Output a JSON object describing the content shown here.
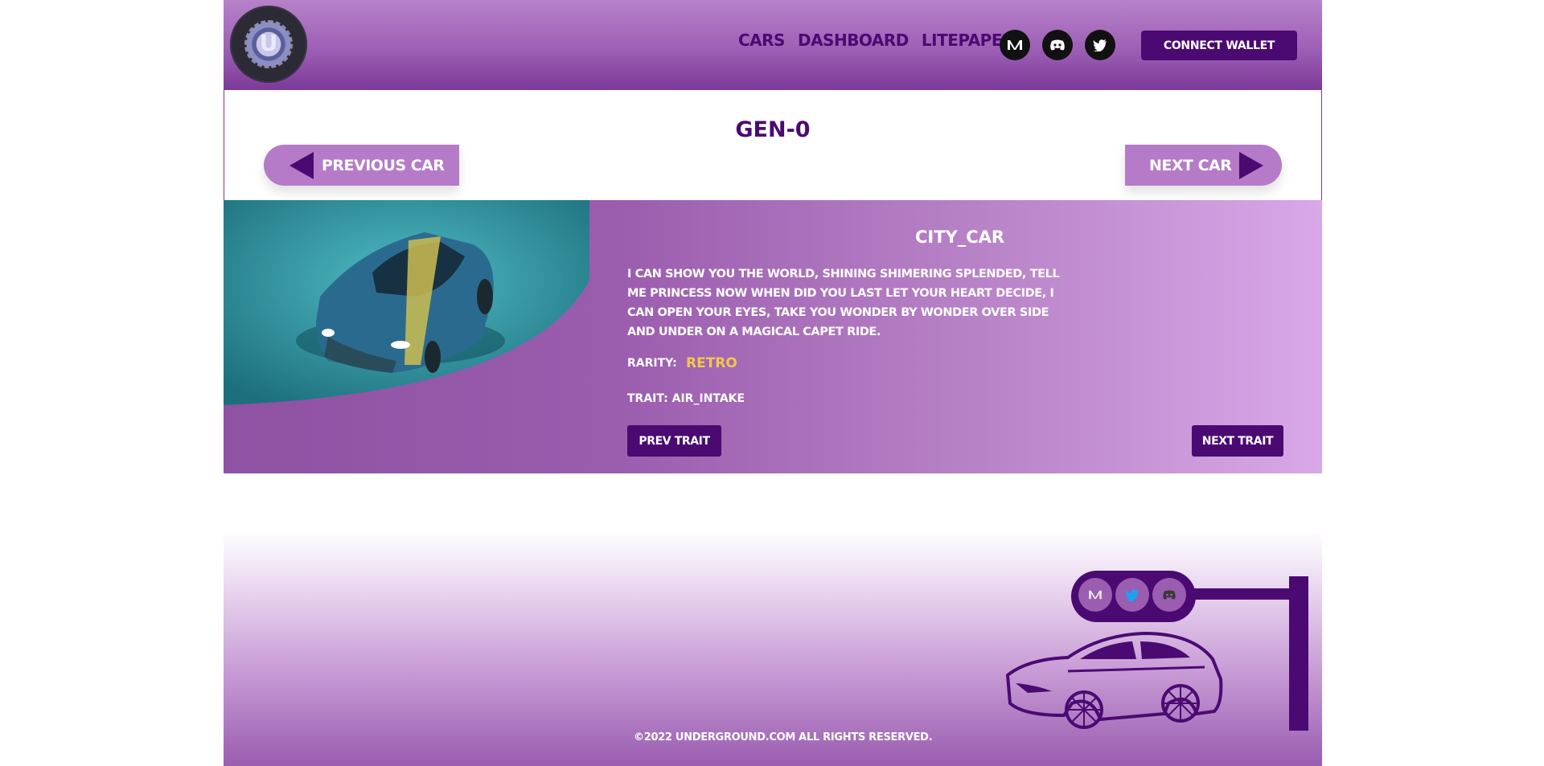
{
  "header": {
    "nav": [
      "CARS",
      "DASHBOARD",
      "LITEPAPER"
    ],
    "logo_letter": "U",
    "social_icons": [
      "medium-icon",
      "discord-icon",
      "twitter-icon"
    ],
    "connect_label": "CONNECT WALLET"
  },
  "gen": {
    "title": "GEN-0",
    "prev_label": "PREVIOUS CAR",
    "next_label": "NEXT CAR"
  },
  "car": {
    "name": "CITY_CAR",
    "description": "I CAN SHOW YOU THE WORLD, SHINING SHIMERING SPLENDED, TELL ME PRINCESS NOW WHEN DID YOU LAST LET YOUR HEART DECIDE, I CAN OPEN YOUR EYES, TAKE YOU WONDER BY WONDER OVER SIDE AND UNDER ON A MAGICAL CAPET RIDE.",
    "rarity_label": "RARITY:",
    "rarity_value": "RETRO",
    "trait": "TRAIT: AIR_INTAKE",
    "prev_trait": "PREV TRAIT",
    "next_trait": "NEXT TRAIT"
  },
  "footer": {
    "social_icons": [
      "medium-icon",
      "twitter-icon",
      "discord-icon"
    ],
    "copyright": "©2022 UNDERGROUND.COM   ALL RIGHTS RESERVED."
  },
  "colors": {
    "brand": "#4b0a72",
    "accent": "#b57bc8",
    "rarity": "#f2c84b"
  }
}
